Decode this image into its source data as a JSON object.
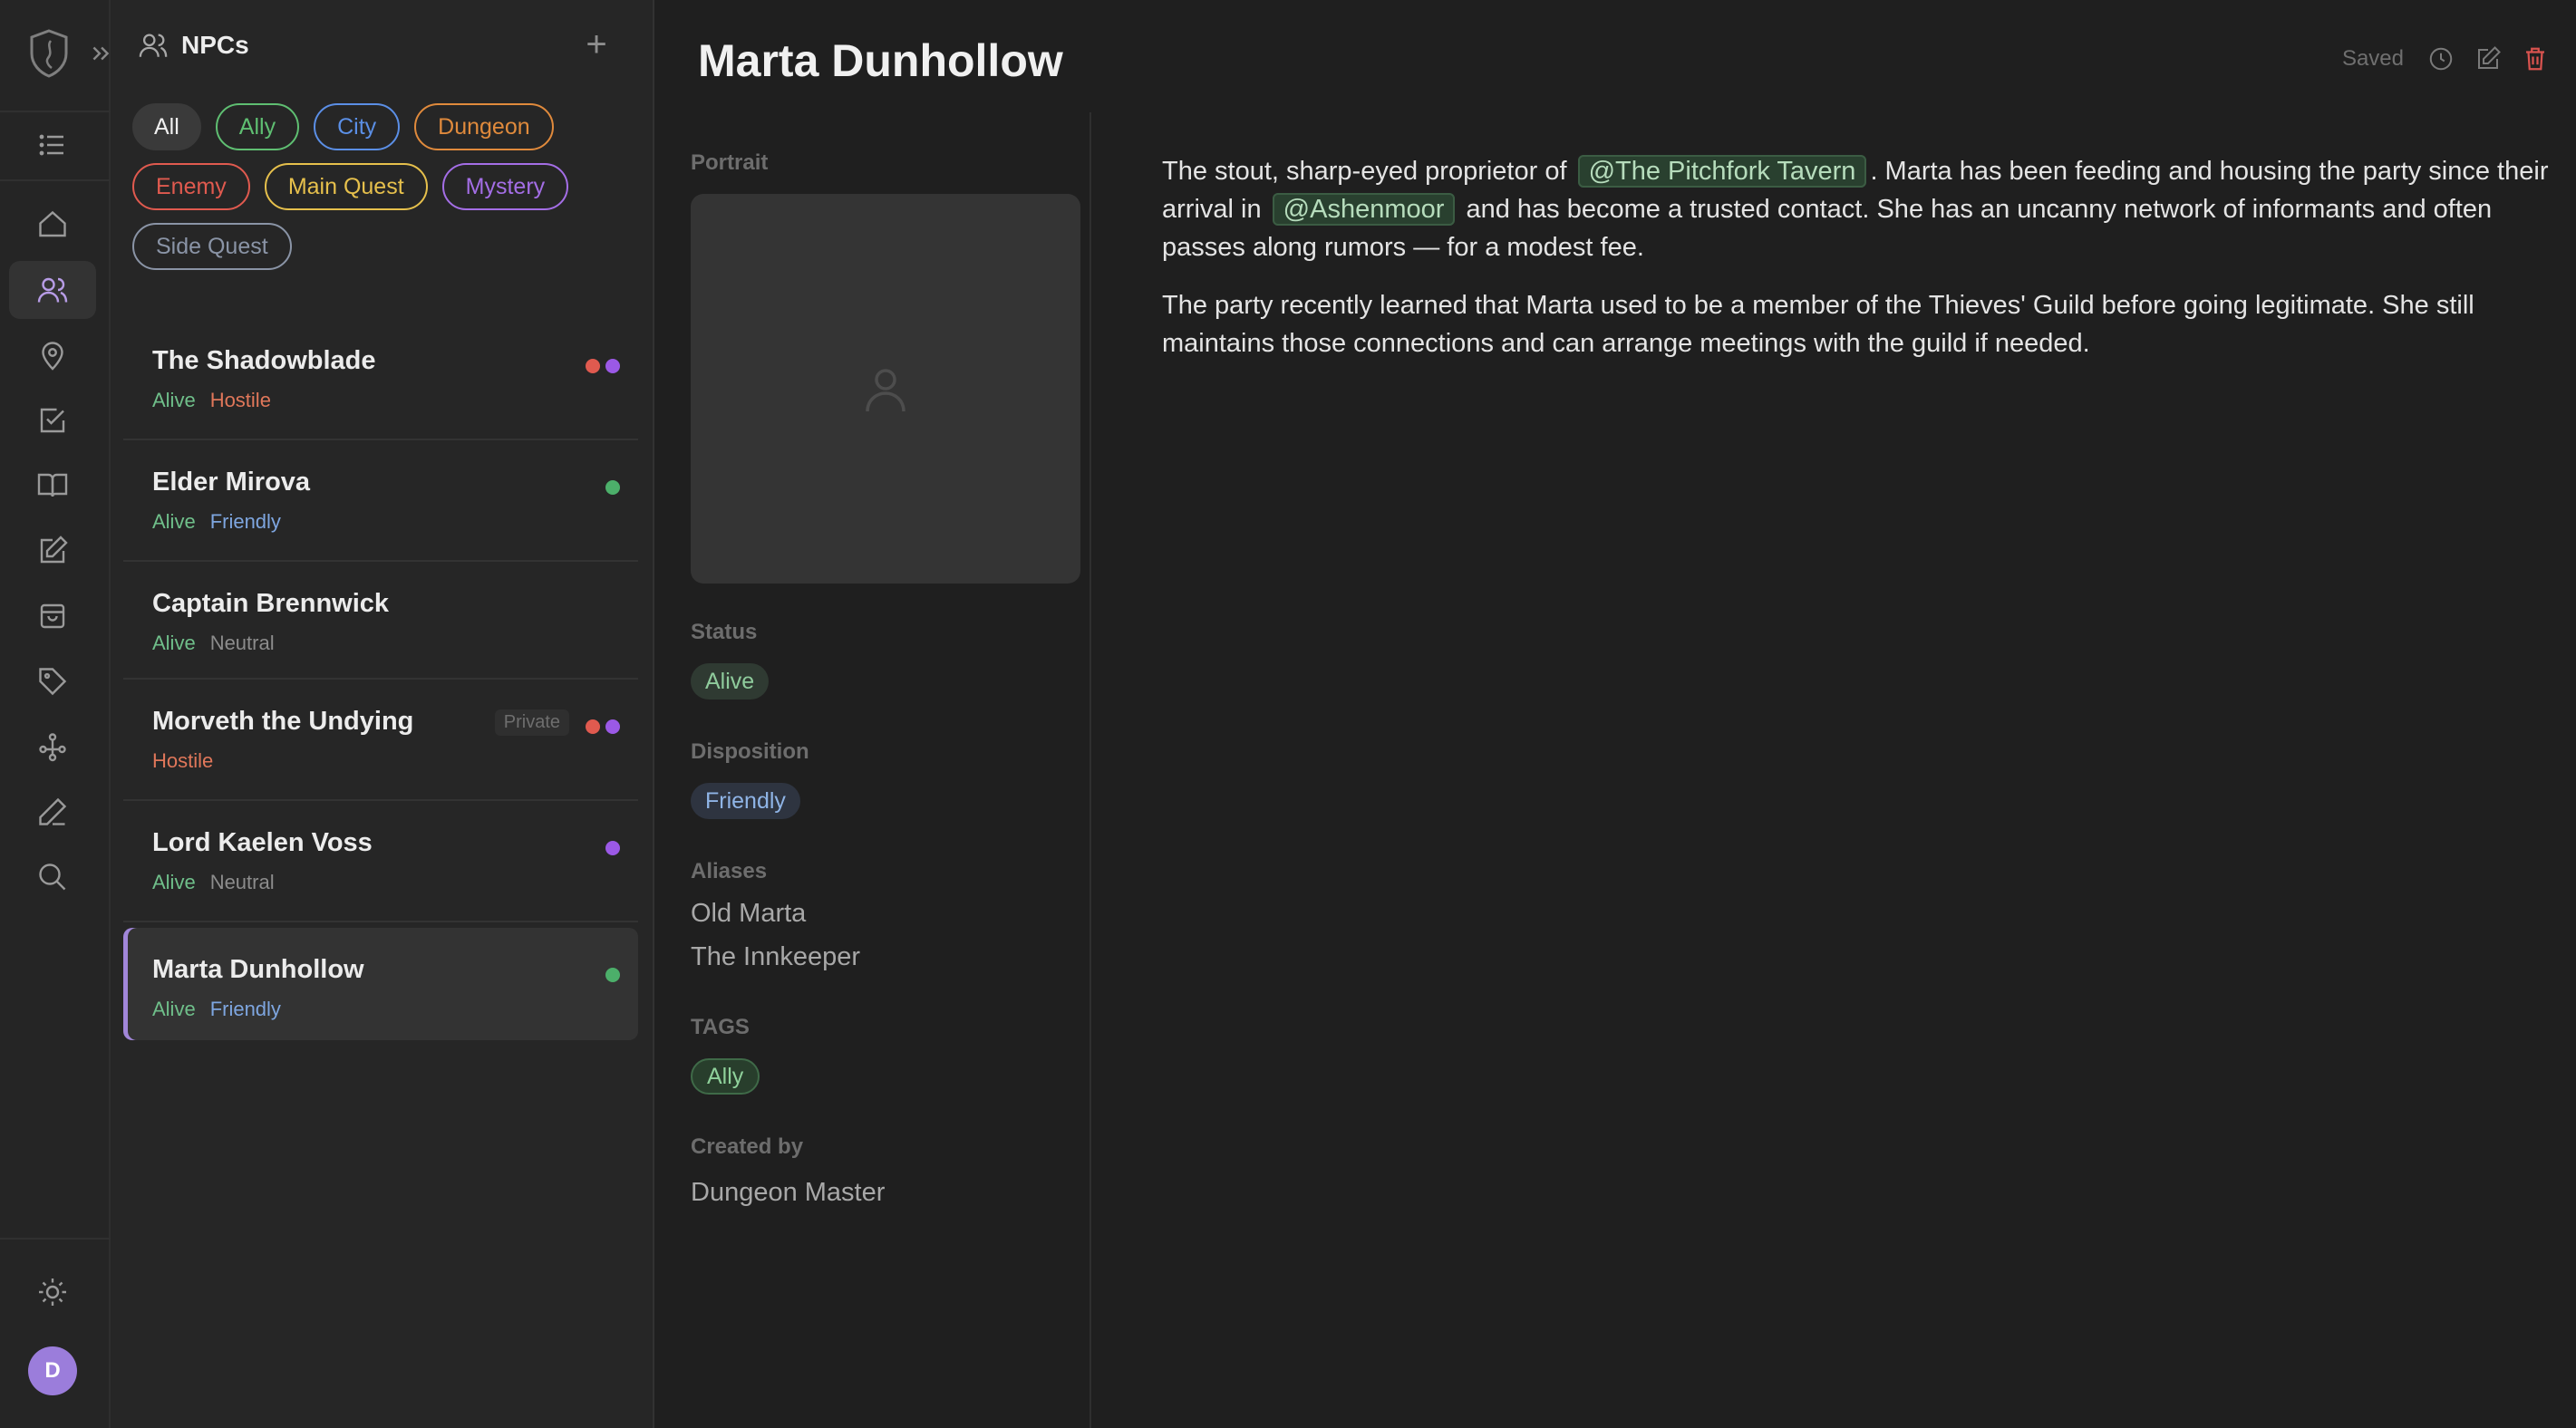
{
  "colors": {
    "accent": "#b79ce6",
    "status_alive": "#6fbf8a",
    "hostile": "#e0775a",
    "friendly": "#7ea6e0",
    "neutral": "#8c8c8c",
    "dot_red": "#e05a4f",
    "dot_purple": "#9b59e6",
    "dot_green": "#4caf6a"
  },
  "rail": {
    "icons": [
      "logo-shield-icon",
      "expand-icon",
      "list-icon",
      "home-icon",
      "users-icon",
      "map-pin-icon",
      "checkbox-icon",
      "book-icon",
      "edit-icon",
      "bag-icon",
      "tag-icon",
      "graph-icon",
      "pen-icon",
      "search-icon",
      "sun-icon"
    ],
    "avatar_initial": "D"
  },
  "list": {
    "title": "NPCs",
    "add_label": "+",
    "filters": [
      {
        "label": "All",
        "color": "#f0f0f0"
      },
      {
        "label": "Ally",
        "color": "#5fbf72"
      },
      {
        "label": "City",
        "color": "#5b8fe6"
      },
      {
        "label": "Dungeon",
        "color": "#e08a3c"
      },
      {
        "label": "Enemy",
        "color": "#e05a4f"
      },
      {
        "label": "Main Quest",
        "color": "#e6c04c"
      },
      {
        "label": "Mystery",
        "color": "#a46ee6"
      },
      {
        "label": "Side Quest",
        "color": "#8a94a6"
      }
    ],
    "npcs": [
      {
        "name": "The Shadowblade",
        "status": "Alive",
        "disposition": "Hostile",
        "disposition_color": "#e0775a",
        "dots": [
          "#e05a4f",
          "#9b59e6"
        ],
        "private": ""
      },
      {
        "name": "Elder Mirova",
        "status": "Alive",
        "disposition": "Friendly",
        "disposition_color": "#7ea6e0",
        "dots": [
          "#4caf6a"
        ],
        "private": ""
      },
      {
        "name": "Captain Brennwick",
        "status": "Alive",
        "disposition": "Neutral",
        "disposition_color": "#8c8c8c",
        "dots": [],
        "private": ""
      },
      {
        "name": "Morveth the Undying",
        "status": "",
        "disposition": "Hostile",
        "disposition_color": "#e0775a",
        "dots": [
          "#e05a4f",
          "#9b59e6"
        ],
        "private": "Private"
      },
      {
        "name": "Lord Kaelen Voss",
        "status": "Alive",
        "disposition": "Neutral",
        "disposition_color": "#8c8c8c",
        "dots": [
          "#9b59e6"
        ],
        "private": ""
      },
      {
        "name": "Marta Dunhollow",
        "status": "Alive",
        "disposition": "Friendly",
        "disposition_color": "#7ea6e0",
        "dots": [
          "#4caf6a"
        ],
        "private": ""
      }
    ]
  },
  "detail": {
    "title": "Marta Dunhollow",
    "saved_label": "Saved",
    "portrait_label": "Portrait",
    "status_label": "Status",
    "status_value": "Alive",
    "disposition_label": "Disposition",
    "disposition_value": "Friendly",
    "aliases_label": "Aliases",
    "aliases": [
      "Old Marta",
      "The Innkeeper"
    ],
    "tags_label": "TAGS",
    "tag": "Ally",
    "created_by_label": "Created by",
    "created_by": "Dungeon Master",
    "p1_a": "The stout, sharp-eyed proprietor of",
    "mention1": "@The Pitchfork Tavern",
    "p1_b": ". Marta has been feeding and housing the party since their arrival in",
    "mention2": "@Ashenmoor",
    "p1_c": "and has become a trusted contact. She has an uncanny network of informants and often passes along rumors — for a modest fee.",
    "p2": "The party recently learned that Marta used to be a member of the Thieves' Guild before going legitimate. She still maintains those connections and can arrange meetings with the guild if needed."
  }
}
